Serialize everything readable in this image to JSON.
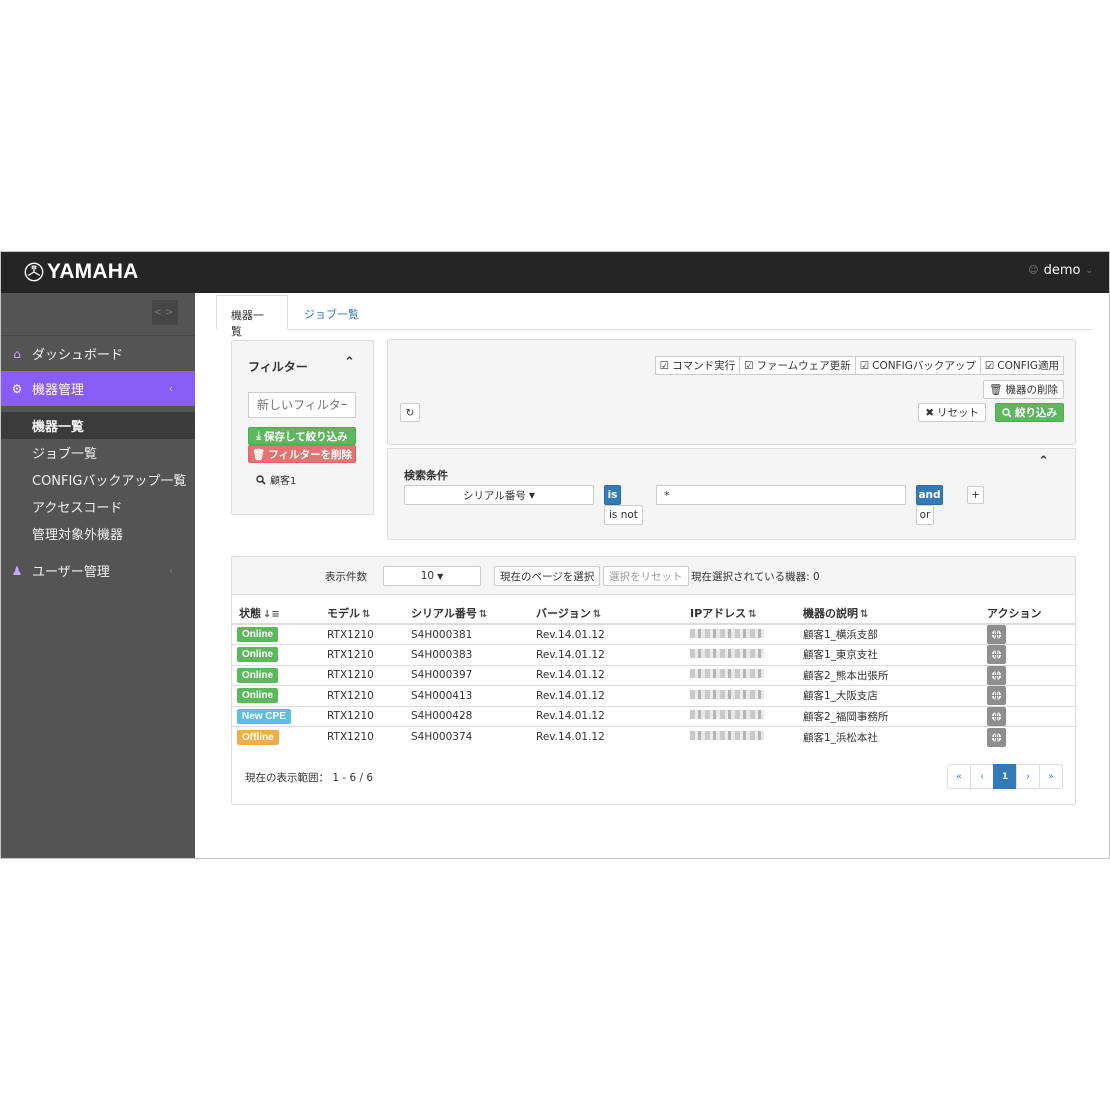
{
  "header": {
    "logo_text": "YAMAHA",
    "user": "demo"
  },
  "sidebar": {
    "items": [
      {
        "label": "ダッシュボード",
        "icon": "home-icon"
      },
      {
        "label": "機器管理",
        "icon": "gears-icon",
        "active": true
      },
      {
        "label": "ユーザー管理",
        "icon": "users-icon"
      }
    ],
    "subitems": [
      "機器一覧",
      "ジョブ一覧",
      "CONFIGバックアップ一覧",
      "アクセスコード",
      "管理対象外機器"
    ]
  },
  "tabs": [
    "機器一覧",
    "ジョブ一覧"
  ],
  "filter_panel": {
    "title": "フィルター",
    "placeholder": "新しいフィルター",
    "save_label": "保存して絞り込み",
    "delete_label": "フィルターを削除",
    "saved_filter": "顧客1"
  },
  "actions": {
    "command": "コマンド実行",
    "firmware": "ファームウェア更新",
    "config_backup": "CONFIGバックアップ",
    "config_apply": "CONFIG適用",
    "delete_device": "機器の削除",
    "reset": "リセット",
    "search": "絞り込み"
  },
  "search_conditions": {
    "title": "検索条件",
    "field": "シリアル番号",
    "op_is": "is",
    "op_isnot": "is not",
    "value": "*",
    "logic_and": "and",
    "logic_or": "or",
    "add": "+"
  },
  "table_toolbar": {
    "per_page_label": "表示件数",
    "per_page_value": "10",
    "select_page": "現在のページを選択",
    "reset_selection": "選択をリセット",
    "selected_count": "現在選択されている機器: 0"
  },
  "table": {
    "columns": [
      "状態",
      "モデル",
      "シリアル番号",
      "バージョン",
      "IPアドレス",
      "機器の説明",
      "アクション"
    ],
    "rows": [
      {
        "status": "Online",
        "model": "RTX1210",
        "serial": "S4H000381",
        "version": "Rev.14.01.12",
        "description": "顧客1_横浜支部"
      },
      {
        "status": "Online",
        "model": "RTX1210",
        "serial": "S4H000383",
        "version": "Rev.14.01.12",
        "description": "顧客1_東京支社"
      },
      {
        "status": "Online",
        "model": "RTX1210",
        "serial": "S4H000397",
        "version": "Rev.14.01.12",
        "description": "顧客2_熊本出張所"
      },
      {
        "status": "Online",
        "model": "RTX1210",
        "serial": "S4H000413",
        "version": "Rev.14.01.12",
        "description": "顧客1_大阪支店"
      },
      {
        "status": "New CPE",
        "model": "RTX1210",
        "serial": "S4H000428",
        "version": "Rev.14.01.12",
        "description": "顧客2_福岡事務所"
      },
      {
        "status": "Offline",
        "model": "RTX1210",
        "serial": "S4H000374",
        "version": "Rev.14.01.12",
        "description": "顧客1_浜松本社"
      }
    ],
    "status_colors": {
      "Online": "#5cb85c",
      "New CPE": "#5bc0de",
      "Offline": "#f0ad4e"
    }
  },
  "footer": {
    "range": "現在の表示範囲： 1 - 6 / 6",
    "pager": [
      "«",
      "‹",
      "1",
      "›",
      "»"
    ]
  },
  "colors": {
    "accent": "#8a5cf7",
    "topbar": "#252525",
    "sidebar": "#545454"
  }
}
